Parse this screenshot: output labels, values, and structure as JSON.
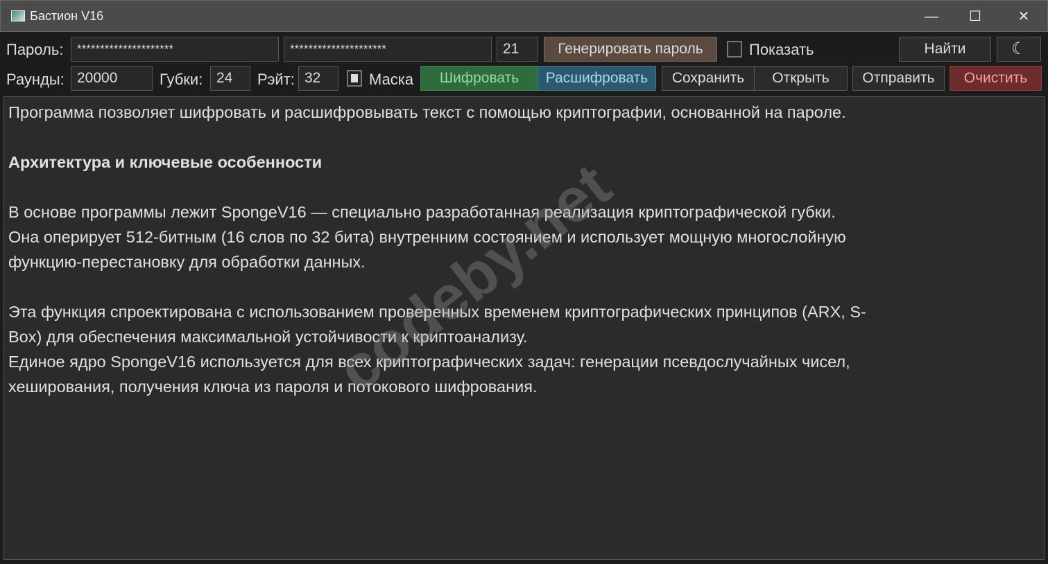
{
  "window": {
    "title": "Бастион V16",
    "minimize": "—",
    "maximize": "☐",
    "close": "✕"
  },
  "row1": {
    "password_label": "Пароль:",
    "password1": "*********************",
    "password2": "*********************",
    "length": "21",
    "generate": "Генерировать пароль",
    "show_label": "Показать",
    "find": "Найти",
    "theme_icon": "☾"
  },
  "row2": {
    "rounds_label": "Раунды:",
    "rounds": "20000",
    "sponges_label": "Губки:",
    "sponges": "24",
    "rate_label": "Рэйт:",
    "rate": "32",
    "mask_label": "Маска",
    "encrypt": "Шифровать",
    "decrypt": "Расшифровать",
    "save": "Сохранить",
    "open": "Открыть",
    "send": "Отправить",
    "clear": "Очистить"
  },
  "colors": {
    "encrypt": "#2f6b3f",
    "decrypt": "#2b5a6e",
    "clear": "#6e2b2b",
    "generate": "#5a4a40"
  },
  "editor": {
    "lines": [
      "Программа позволяет шифровать и расшифровывать текст с помощью криптографии, основанной на пароле.",
      "",
      "Архитектура и ключевые особенности",
      "",
      "В основе программы лежит SpongeV16 — специально разработанная реализация криптографической губки.",
      "Она оперирует 512-битным (16 слов по 32 бита) внутренним состоянием и использует мощную многослойную",
      "функцию-перестановку для обработки данных.",
      "",
      "Эта функция спроектирована с использованием проверенных временем криптографических принципов (ARX, S-",
      "Box) для обеспечения максимальной устойчивости к криптоанализу.",
      "Единое ядро SpongeV16 используется для всех криптографических задач: генерации псевдослучайных чисел,",
      "хеширования, получения ключа из пароля и потокового шифрования."
    ]
  },
  "watermark": "codeby.net"
}
